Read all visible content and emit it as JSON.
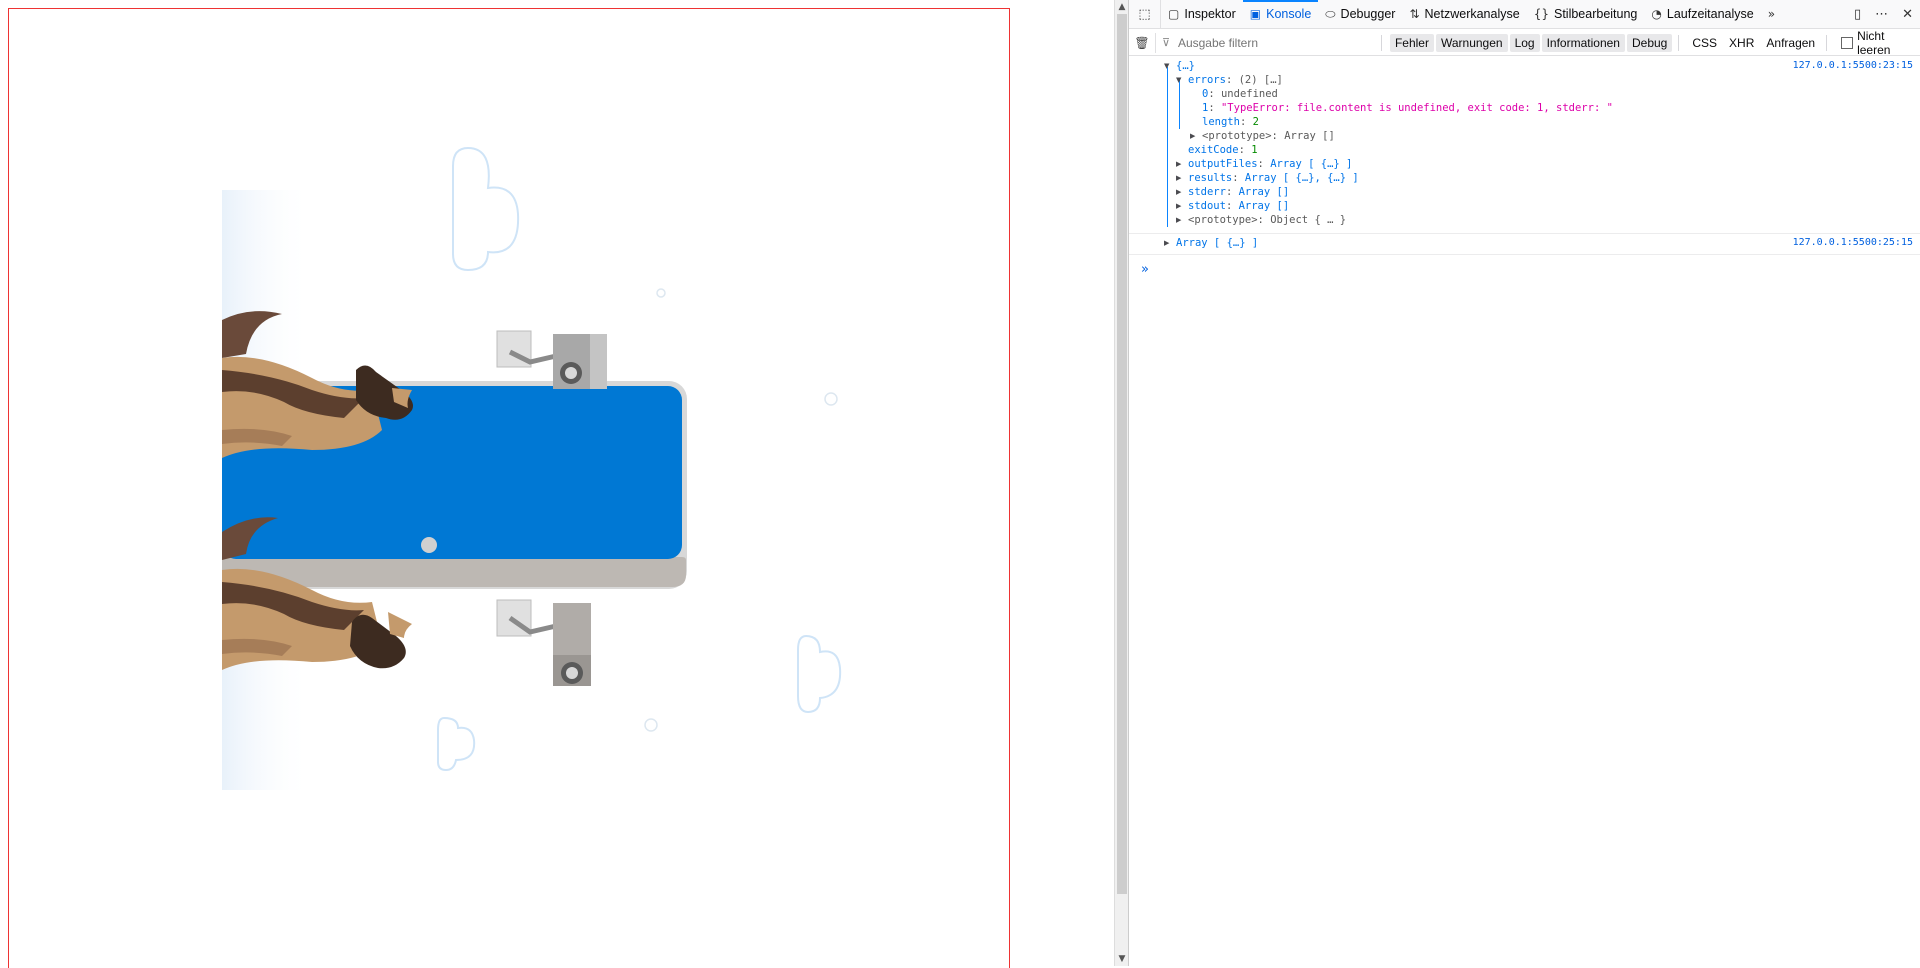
{
  "devtools": {
    "tabs": [
      {
        "label": "Inspektor",
        "icon": "inspector-icon"
      },
      {
        "label": "Konsole",
        "icon": "console-icon",
        "active": true
      },
      {
        "label": "Debugger",
        "icon": "debugger-icon"
      },
      {
        "label": "Netzwerkanalyse",
        "icon": "network-icon"
      },
      {
        "label": "Stilbearbeitung",
        "icon": "style-editor-icon"
      },
      {
        "label": "Laufzeitanalyse",
        "icon": "performance-icon"
      }
    ],
    "filter": {
      "placeholder": "Ausgabe filtern",
      "levels": [
        "Fehler",
        "Warnungen",
        "Log",
        "Informationen",
        "Debug"
      ],
      "types": [
        "CSS",
        "XHR",
        "Anfragen"
      ],
      "persist_label": "Nicht leeren"
    },
    "messages": [
      {
        "location": "127.0.0.1:5500:23:15",
        "summary": "{…}",
        "lines": [
          {
            "key": "errors",
            "value": "(2) […]"
          },
          {
            "key": "0",
            "value": "undefined"
          },
          {
            "key": "1",
            "value": "\"TypeError: file.content is undefined, exit code: 1, stderr: \""
          },
          {
            "key": "length",
            "value": "2"
          },
          {
            "key": "<prototype>",
            "value": "Array []"
          },
          {
            "key": "exitCode",
            "value": "1"
          },
          {
            "key": "outputFiles",
            "value": "Array [ {…} ]"
          },
          {
            "key": "results",
            "value": "Array [ {…}, {…} ]"
          },
          {
            "key": "stderr",
            "value": "Array []"
          },
          {
            "key": "stdout",
            "value": "Array []"
          },
          {
            "key": "<prototype>",
            "value": "Object { … }"
          }
        ]
      },
      {
        "location": "127.0.0.1:5500:25:15",
        "summary": "Array [ {…} ]"
      }
    ]
  },
  "colors": {
    "accent": "#0a84ff",
    "frame_border": "#ee3333",
    "card_blue": "#0078d4"
  }
}
